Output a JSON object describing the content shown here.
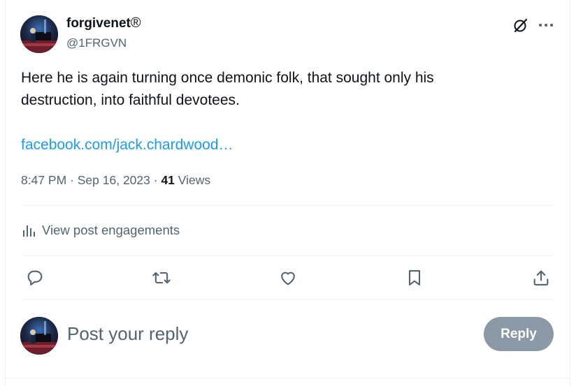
{
  "author": {
    "name": "forgivenet",
    "badge": "®",
    "handle": "@1FRGVN",
    "avatar_icon": "pianist-avatar"
  },
  "header_icons": {
    "grok": "grok-icon",
    "more": "more-icon",
    "more_glyph": "···"
  },
  "tweet": {
    "text": "Here he is again turning once demonic folk, that sought only his destruction, into faithful devotees.",
    "link": "facebook.com/jack.chardwood…",
    "time": "8:47 PM",
    "sep1": " · ",
    "date": "Sep 16, 2023",
    "sep2": " · ",
    "views_count": "41",
    "views_label": " Views"
  },
  "engagements": {
    "label": "View post engagements"
  },
  "actions": [
    "reply-icon",
    "repost-icon",
    "like-icon",
    "bookmark-icon",
    "share-icon"
  ],
  "reply_box": {
    "placeholder": "Post your reply",
    "button_label": "Reply"
  },
  "colors": {
    "link": "#1d9bf0",
    "secondary_text": "#536471",
    "reply_button_disabled": "#8b98a5",
    "divider": "#eff3f4"
  }
}
